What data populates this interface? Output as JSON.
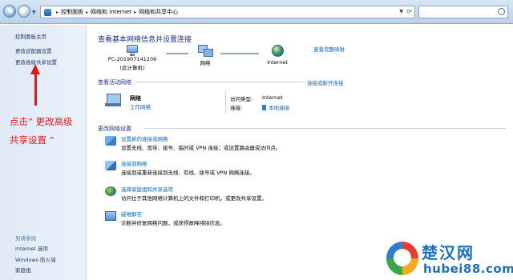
{
  "address_bar": {
    "crumbs": [
      "控制面板",
      "网络和 Internet",
      "网络和共享中心"
    ]
  },
  "sidebar": {
    "home": "控制面板主页",
    "links": [
      "更改适配器设置",
      "更改高级共享设置"
    ],
    "see_also_title": "另请参阅",
    "see_also": [
      "Internet 选项",
      "Windows 防火墙",
      "家庭组"
    ]
  },
  "annotation": {
    "text": "点击“ 更改高级共享设置 ”",
    "color": "#e2171b"
  },
  "main": {
    "title": "查看基本网络信息并设置连接",
    "full_map": "查看完整映射",
    "map": {
      "computer": "PC-201907141206",
      "computer_sub": "(此计算机)",
      "network": "网络",
      "internet": "Internet"
    },
    "active": {
      "title": "查看活动网络",
      "connect_link": "连接或断开连接",
      "network_name": "网络",
      "network_type": "工作网络",
      "access_label": "访问类型:",
      "access_value": "Internet",
      "conn_label": "连接:",
      "conn_value": "本地连接"
    },
    "change": {
      "title": "更改网络设置",
      "tasks": [
        {
          "link": "设置新的连接或网络",
          "desc": "设置无线、宽带、拨号、临时或 VPN 连接；或设置路由器或访问点。",
          "icon": "new-connection-icon"
        },
        {
          "link": "连接到网络",
          "desc": "连接到或重新连接到无线、有线、拨号或 VPN 网络连接。",
          "icon": "connect-network-icon"
        },
        {
          "link": "选择家庭组和共享选项",
          "desc": "访问位于其他网络计算机上的文件和打印机，或更改共享设置。",
          "icon": "homegroup-icon"
        },
        {
          "link": "疑难解答",
          "desc": "诊断并修复网络问题，或获得故障排除信息。",
          "icon": "troubleshoot-icon"
        }
      ]
    }
  },
  "watermark": {
    "cn": "楚汉网",
    "en": "hubei88.com"
  },
  "colors": {
    "link": "#0066cc",
    "heading": "#1e3287",
    "annotation": "#e2171b"
  }
}
